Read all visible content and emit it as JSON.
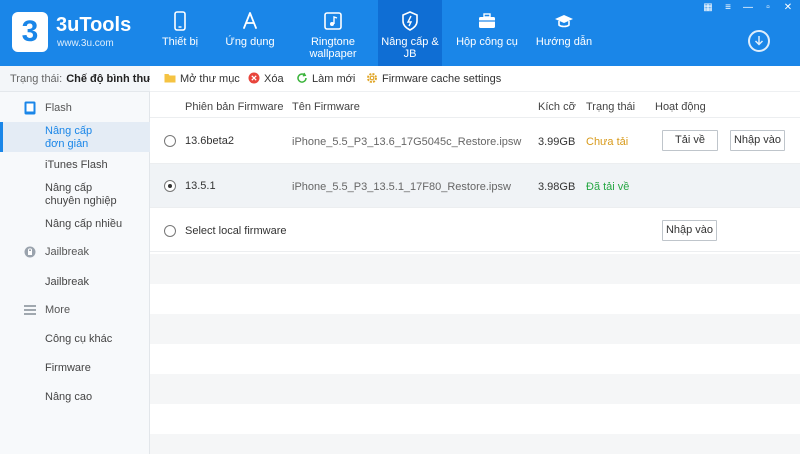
{
  "app": {
    "name": "3uTools",
    "url": "www.3u.com",
    "logo_char": "3"
  },
  "nav": [
    {
      "label": "Thiết bị",
      "icon": "phone-icon"
    },
    {
      "label": "Ứng dụng",
      "icon": "app-store-icon"
    },
    {
      "label": "Ringtone wallpaper",
      "icon": "music-icon"
    },
    {
      "label": "Nâng cấp & JB",
      "icon": "flash-icon"
    },
    {
      "label": "Hộp công cụ",
      "icon": "toolbox-icon"
    },
    {
      "label": "Hướng dẫn",
      "icon": "graduation-cap-icon"
    }
  ],
  "window_controls": [
    "▦",
    "≡",
    "—",
    "▫",
    "✕"
  ],
  "status": {
    "label": "Trạng thái:",
    "value": "Chế độ bình thường"
  },
  "sidebar": {
    "groups": [
      {
        "label": "Flash",
        "icon": "tablet-icon",
        "items": [
          "Nâng cấp đơn giản",
          "iTunes Flash",
          "Nâng cấp chuyên nghiệp",
          "Nâng cấp nhiều"
        ]
      },
      {
        "label": "Jailbreak",
        "icon": "lock-icon",
        "items": [
          "Jailbreak"
        ]
      },
      {
        "label": "More",
        "icon": "menu-icon",
        "items": [
          "Công cụ khác",
          "Firmware",
          "Nâng cao"
        ]
      }
    ]
  },
  "toolbar": {
    "open_folder": "Mở thư mục",
    "delete": "Xóa",
    "refresh": "Làm mới",
    "cache_settings": "Firmware cache settings"
  },
  "table": {
    "headers": {
      "version": "Phiên bản Firmware",
      "name": "Tên Firmware",
      "size": "Kích cỡ",
      "status": "Trạng thái",
      "action": "Hoạt động"
    },
    "rows": [
      {
        "version": "13.6beta2",
        "name": "iPhone_5.5_P3_13.6_17G5045c_Restore.ipsw",
        "size": "3.99GB",
        "status": "Chưa tải",
        "download": "Tải về",
        "import": "Nhập vào",
        "selected": false
      },
      {
        "version": "13.5.1",
        "name": "iPhone_5.5_P3_13.5.1_17F80_Restore.ipsw",
        "size": "3.98GB",
        "status": "Đã tải về",
        "selected": true
      }
    ],
    "local": {
      "label": "Select local firmware",
      "import": "Nhập vào"
    }
  },
  "colors": {
    "header": "#1a86e8",
    "active_nav": "#0f6ed4",
    "status_warn": "#d89a1a",
    "status_ok": "#27a744"
  }
}
